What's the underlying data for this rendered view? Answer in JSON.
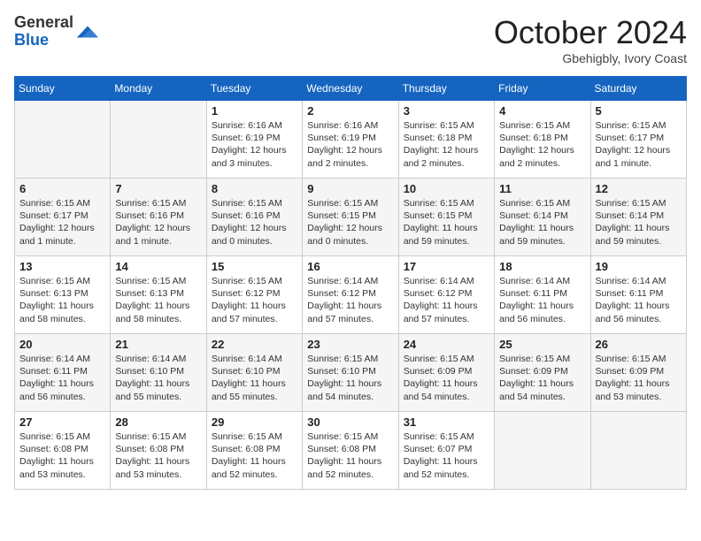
{
  "header": {
    "logo_line1": "General",
    "logo_line2": "Blue",
    "month": "October 2024",
    "location": "Gbehigbly, Ivory Coast"
  },
  "days_of_week": [
    "Sunday",
    "Monday",
    "Tuesday",
    "Wednesday",
    "Thursday",
    "Friday",
    "Saturday"
  ],
  "weeks": [
    [
      {
        "day": "",
        "info": ""
      },
      {
        "day": "",
        "info": ""
      },
      {
        "day": "1",
        "info": "Sunrise: 6:16 AM\nSunset: 6:19 PM\nDaylight: 12 hours and 3 minutes."
      },
      {
        "day": "2",
        "info": "Sunrise: 6:16 AM\nSunset: 6:19 PM\nDaylight: 12 hours and 2 minutes."
      },
      {
        "day": "3",
        "info": "Sunrise: 6:15 AM\nSunset: 6:18 PM\nDaylight: 12 hours and 2 minutes."
      },
      {
        "day": "4",
        "info": "Sunrise: 6:15 AM\nSunset: 6:18 PM\nDaylight: 12 hours and 2 minutes."
      },
      {
        "day": "5",
        "info": "Sunrise: 6:15 AM\nSunset: 6:17 PM\nDaylight: 12 hours and 1 minute."
      }
    ],
    [
      {
        "day": "6",
        "info": "Sunrise: 6:15 AM\nSunset: 6:17 PM\nDaylight: 12 hours and 1 minute."
      },
      {
        "day": "7",
        "info": "Sunrise: 6:15 AM\nSunset: 6:16 PM\nDaylight: 12 hours and 1 minute."
      },
      {
        "day": "8",
        "info": "Sunrise: 6:15 AM\nSunset: 6:16 PM\nDaylight: 12 hours and 0 minutes."
      },
      {
        "day": "9",
        "info": "Sunrise: 6:15 AM\nSunset: 6:15 PM\nDaylight: 12 hours and 0 minutes."
      },
      {
        "day": "10",
        "info": "Sunrise: 6:15 AM\nSunset: 6:15 PM\nDaylight: 11 hours and 59 minutes."
      },
      {
        "day": "11",
        "info": "Sunrise: 6:15 AM\nSunset: 6:14 PM\nDaylight: 11 hours and 59 minutes."
      },
      {
        "day": "12",
        "info": "Sunrise: 6:15 AM\nSunset: 6:14 PM\nDaylight: 11 hours and 59 minutes."
      }
    ],
    [
      {
        "day": "13",
        "info": "Sunrise: 6:15 AM\nSunset: 6:13 PM\nDaylight: 11 hours and 58 minutes."
      },
      {
        "day": "14",
        "info": "Sunrise: 6:15 AM\nSunset: 6:13 PM\nDaylight: 11 hours and 58 minutes."
      },
      {
        "day": "15",
        "info": "Sunrise: 6:15 AM\nSunset: 6:12 PM\nDaylight: 11 hours and 57 minutes."
      },
      {
        "day": "16",
        "info": "Sunrise: 6:14 AM\nSunset: 6:12 PM\nDaylight: 11 hours and 57 minutes."
      },
      {
        "day": "17",
        "info": "Sunrise: 6:14 AM\nSunset: 6:12 PM\nDaylight: 11 hours and 57 minutes."
      },
      {
        "day": "18",
        "info": "Sunrise: 6:14 AM\nSunset: 6:11 PM\nDaylight: 11 hours and 56 minutes."
      },
      {
        "day": "19",
        "info": "Sunrise: 6:14 AM\nSunset: 6:11 PM\nDaylight: 11 hours and 56 minutes."
      }
    ],
    [
      {
        "day": "20",
        "info": "Sunrise: 6:14 AM\nSunset: 6:11 PM\nDaylight: 11 hours and 56 minutes."
      },
      {
        "day": "21",
        "info": "Sunrise: 6:14 AM\nSunset: 6:10 PM\nDaylight: 11 hours and 55 minutes."
      },
      {
        "day": "22",
        "info": "Sunrise: 6:14 AM\nSunset: 6:10 PM\nDaylight: 11 hours and 55 minutes."
      },
      {
        "day": "23",
        "info": "Sunrise: 6:15 AM\nSunset: 6:10 PM\nDaylight: 11 hours and 54 minutes."
      },
      {
        "day": "24",
        "info": "Sunrise: 6:15 AM\nSunset: 6:09 PM\nDaylight: 11 hours and 54 minutes."
      },
      {
        "day": "25",
        "info": "Sunrise: 6:15 AM\nSunset: 6:09 PM\nDaylight: 11 hours and 54 minutes."
      },
      {
        "day": "26",
        "info": "Sunrise: 6:15 AM\nSunset: 6:09 PM\nDaylight: 11 hours and 53 minutes."
      }
    ],
    [
      {
        "day": "27",
        "info": "Sunrise: 6:15 AM\nSunset: 6:08 PM\nDaylight: 11 hours and 53 minutes."
      },
      {
        "day": "28",
        "info": "Sunrise: 6:15 AM\nSunset: 6:08 PM\nDaylight: 11 hours and 53 minutes."
      },
      {
        "day": "29",
        "info": "Sunrise: 6:15 AM\nSunset: 6:08 PM\nDaylight: 11 hours and 52 minutes."
      },
      {
        "day": "30",
        "info": "Sunrise: 6:15 AM\nSunset: 6:08 PM\nDaylight: 11 hours and 52 minutes."
      },
      {
        "day": "31",
        "info": "Sunrise: 6:15 AM\nSunset: 6:07 PM\nDaylight: 11 hours and 52 minutes."
      },
      {
        "day": "",
        "info": ""
      },
      {
        "day": "",
        "info": ""
      }
    ]
  ]
}
